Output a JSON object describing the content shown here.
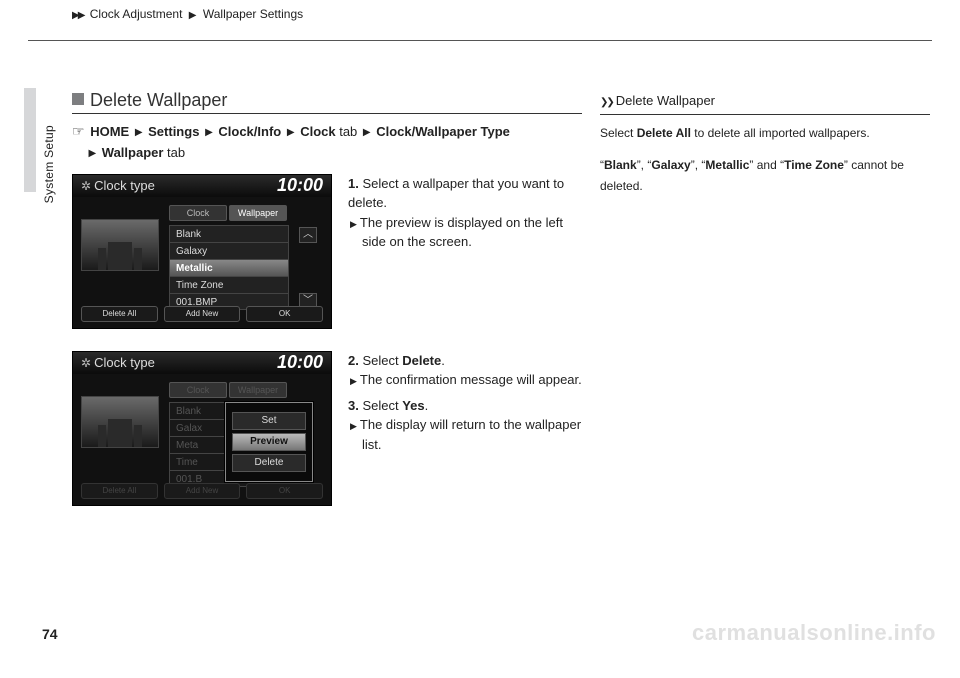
{
  "header": {
    "arrows": "▶▶",
    "breadcrumb1": "Clock Adjustment",
    "sep": "▶",
    "breadcrumb2": "Wallpaper Settings"
  },
  "side_label": "System Setup",
  "page_number": "74",
  "watermark": "carmanualsonline.info",
  "section": {
    "title": "Delete Wallpaper"
  },
  "path": {
    "hand": "☞",
    "home": "HOME",
    "tri": "▶",
    "settings": "Settings",
    "clockinfo": "Clock/Info",
    "clock": "Clock",
    "tab_word": " tab ",
    "cwt": "Clock/Wallpaper Type",
    "wallpaper": "Wallpaper",
    "tab_word2": " tab"
  },
  "shot": {
    "title": "Clock type",
    "time": "10:00",
    "tab_clock": "Clock",
    "tab_wallpaper": "Wallpaper",
    "items": {
      "a": "Blank",
      "b": "Galaxy",
      "c": "Metallic",
      "d": "Time Zone",
      "e": "001.BMP"
    },
    "btn_delete_all": "Delete All",
    "btn_add_new": "Add New",
    "btn_ok": "OK",
    "items2": {
      "a": "Blank",
      "b": "Galax",
      "c": "Meta",
      "d": "Time",
      "e": "001.B"
    },
    "popup": {
      "set": "Set",
      "preview": "Preview",
      "delete": "Delete"
    }
  },
  "steps1": {
    "s1n": "1.",
    "s1": "Select a wallpaper that you want to delete.",
    "s1a": "The preview is displayed on the left side on the screen."
  },
  "steps2": {
    "s2n": "2.",
    "s2a": "Select ",
    "s2b": "Delete",
    "s2c": ".",
    "s2d": "The confirmation message will appear.",
    "s3n": "3.",
    "s3a": "Select ",
    "s3b": "Yes",
    "s3c": ".",
    "s3d": "The display will return to the wallpaper list."
  },
  "right": {
    "icns": "❯❯",
    "title": "Delete Wallpaper",
    "p1a": "Select ",
    "p1b": "Delete All",
    "p1c": " to delete all imported wallpapers.",
    "p2a": "“",
    "p2b": "Blank",
    "p2c": "”, “",
    "p2d": "Galaxy",
    "p2e": "”, “",
    "p2f": "Metallic",
    "p2g": "” and “",
    "p2h": "Time Zone",
    "p2i": "” cannot be deleted."
  }
}
